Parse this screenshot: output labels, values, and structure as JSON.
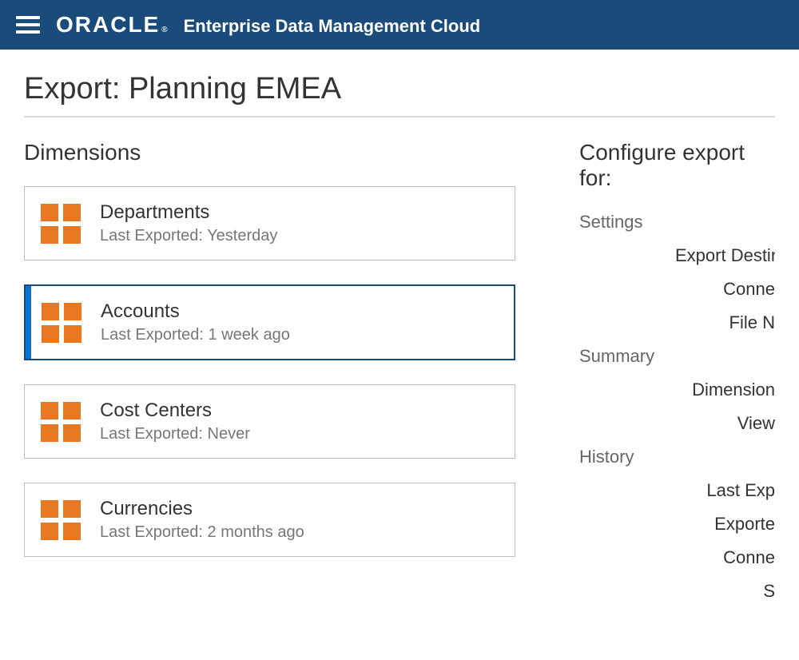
{
  "header": {
    "brand": "ORACLE",
    "product": "Enterprise Data Management Cloud"
  },
  "page": {
    "title": "Export: Planning EMEA"
  },
  "left": {
    "heading": "Dimensions",
    "items": [
      {
        "name": "Departments",
        "meta": "Last Exported: Yesterday",
        "selected": false
      },
      {
        "name": "Accounts",
        "meta": "Last Exported: 1 week ago",
        "selected": true
      },
      {
        "name": "Cost Centers",
        "meta": "Last Exported: Never",
        "selected": false
      },
      {
        "name": "Currencies",
        "meta": "Last Exported: 2 months ago",
        "selected": false
      }
    ]
  },
  "right": {
    "heading": "Configure export for:",
    "groups": [
      {
        "title": "Settings",
        "fields": [
          "Export Destin",
          "Conne",
          "File N"
        ]
      },
      {
        "title": "Summary",
        "fields": [
          "Dimension",
          "View"
        ]
      },
      {
        "title": "History",
        "fields": [
          "Last Exp",
          "Exporte",
          "Conne",
          "S"
        ]
      }
    ]
  }
}
